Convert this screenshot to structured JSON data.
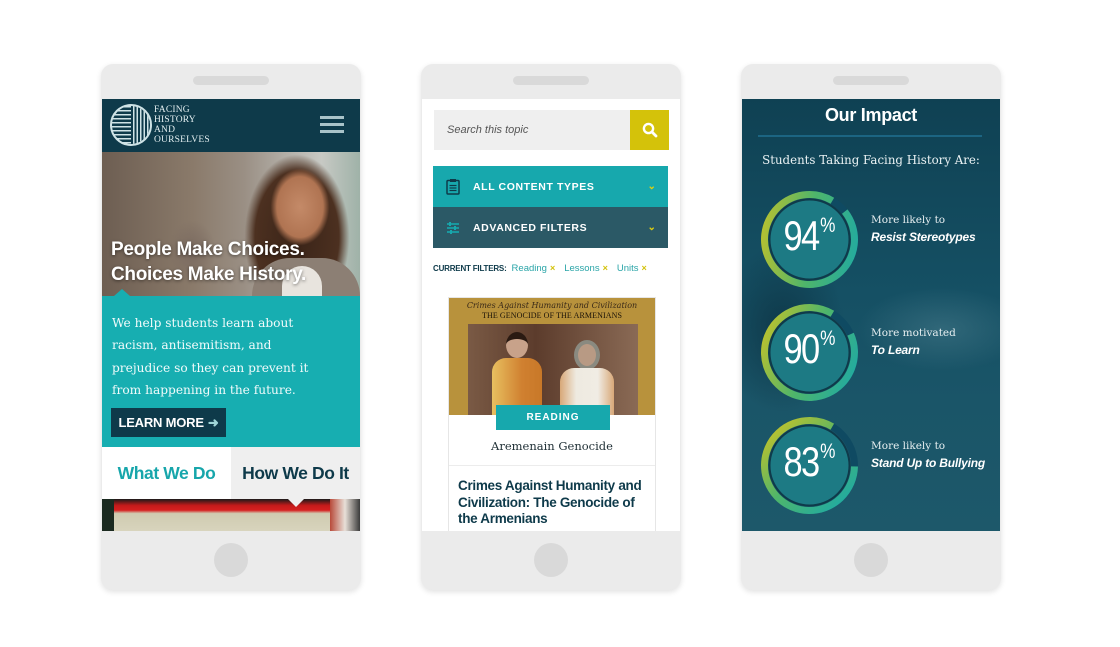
{
  "phone1": {
    "logo_lines": [
      "FACING",
      "HISTORY",
      "AND",
      "OURSELVES"
    ],
    "menu_icon": "hamburger-menu-icon",
    "hero_title_line1": "People Make Choices.",
    "hero_title_line2": "Choices Make History.",
    "intro_text": "We help students learn about racism, antisemitism, and prejudice so they can prevent it from happening in the future.",
    "learn_more_label": "LEARN MORE",
    "learn_more_icon": "arrow-right-icon",
    "tabs": [
      {
        "label": "What We Do",
        "active": true
      },
      {
        "label": "How We Do It",
        "active": false
      }
    ]
  },
  "phone2": {
    "search": {
      "placeholder": "Search this topic",
      "value": "",
      "icon": "search-icon"
    },
    "filters": [
      {
        "label": "ALL CONTENT TYPES",
        "icon": "clipboard-icon",
        "chevron": "chevron-down-icon"
      },
      {
        "label": "ADVANCED FILTERS",
        "icon": "sliders-icon",
        "chevron": "chevron-down-icon"
      }
    ],
    "current_filters_label": "CURRENT FILTERS:",
    "current_filters": [
      "Reading",
      "Lessons",
      "Units"
    ],
    "remove_icon": "×",
    "card": {
      "image_script_title": "Crimes Against Humanity and Civilization",
      "image_caps_title": "THE GENOCIDE OF THE ARMENIANS",
      "badge": "READING",
      "topic": "Aremenain Genocide",
      "title": "Crimes Against Humanity and Civilization: The Genocide of the Armenians"
    }
  },
  "phone3": {
    "title": "Our Impact",
    "subtitle": "Students Taking Facing History Are:",
    "stats": [
      {
        "value": "94",
        "unit": "%",
        "percent": 94,
        "lead": "More likely to",
        "emphasis": "Resist Stereotypes"
      },
      {
        "value": "90",
        "unit": "%",
        "percent": 90,
        "lead": "More motivated",
        "emphasis": "To Learn"
      },
      {
        "value": "83",
        "unit": "%",
        "percent": 83,
        "lead": "More likely to",
        "emphasis": "Stand Up to Bullying"
      }
    ],
    "colors": {
      "ring_start": "#d4c420",
      "ring_mid": "#4fb56a",
      "ring_end": "#17a8ad",
      "ring_gap": "#0f4a62"
    }
  }
}
